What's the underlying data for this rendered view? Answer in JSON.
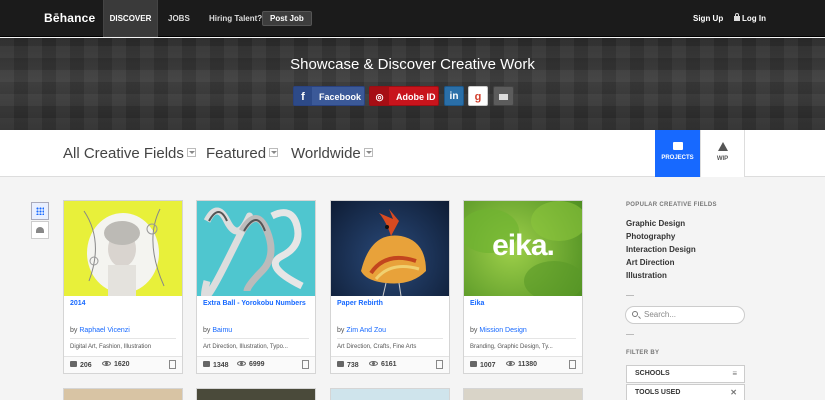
{
  "nav": {
    "logo": "Bēhance",
    "discover": "DISCOVER",
    "jobs": "JOBS",
    "hiring": "Hiring Talent?",
    "post_job": "Post Job",
    "sign_up": "Sign Up",
    "log_in": "Log In"
  },
  "hero": {
    "title": "Showcase & Discover Creative Work",
    "facebook": "Facebook",
    "adobe": "Adobe ID",
    "linkedin_glyph": "in",
    "google_glyph": "g"
  },
  "filters": {
    "fields": "All Creative Fields",
    "featured": "Featured",
    "worldwide": "Worldwide",
    "tab_projects": "PROJECTS",
    "tab_wip": "WIP"
  },
  "cards": [
    {
      "title": "2014",
      "by": "by",
      "author": "Raphael Vicenzi",
      "fields": "Digital Art, Fashion, Illustration",
      "likes": "206",
      "views": "1620"
    },
    {
      "title": "Extra Ball - Yorokobu Numbers",
      "by": "by",
      "author": "Baimu",
      "fields": "Art Direction, Illustration, Typo...",
      "likes": "1348",
      "views": "6999"
    },
    {
      "title": "Paper Rebirth",
      "by": "by",
      "author": "Zim And Zou",
      "fields": "Art Direction, Crafts, Fine Arts",
      "likes": "738",
      "views": "6161"
    },
    {
      "title": "Eika",
      "by": "by",
      "author": "Mission Design",
      "fields": "Branding, Graphic Design, Ty...",
      "likes": "1007",
      "views": "11380"
    }
  ],
  "thumb_text": {
    "eika": "eika."
  },
  "sidebar": {
    "popular_heading": "POPULAR CREATIVE FIELDS",
    "links": [
      "Graphic Design",
      "Photography",
      "Interaction Design",
      "Art Direction",
      "Illustration"
    ],
    "search_placeholder": "Search...",
    "filter_heading": "FILTER BY",
    "schools": "SCHOOLS",
    "tools": "TOOLS USED"
  },
  "colors": {
    "accent": "#1769ff",
    "nav_bg": "#1b1b1b",
    "facebook": "#3b5998",
    "adobe": "#c8141c"
  }
}
